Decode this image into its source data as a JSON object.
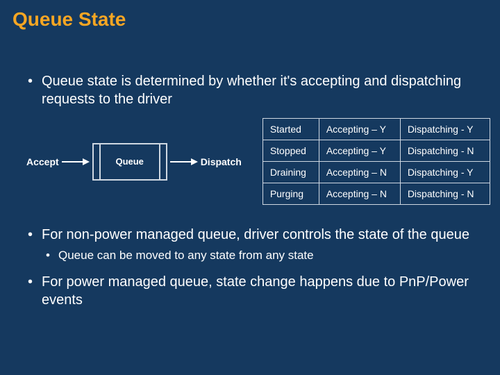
{
  "title": "Queue State",
  "bullets": {
    "b1": "Queue state is determined by whether it's accepting and dispatching requests to the driver",
    "b2": "For non-power managed queue, driver controls the state of the queue",
    "b2_sub": "Queue can be moved to any state from any state",
    "b3": "For power managed queue, state change happens due to PnP/Power events"
  },
  "diagram": {
    "accept_label": "Accept",
    "dispatch_label": "Dispatch",
    "queue_label": "Queue"
  },
  "table": {
    "rows": [
      {
        "state": "Started",
        "accept": "Accepting – Y",
        "dispatch": "Dispatching - Y"
      },
      {
        "state": "Stopped",
        "accept": "Accepting – Y",
        "dispatch": "Dispatching - N"
      },
      {
        "state": "Draining",
        "accept": "Accepting – N",
        "dispatch": "Dispatching - Y"
      },
      {
        "state": "Purging",
        "accept": "Accepting – N",
        "dispatch": "Dispatching - N"
      }
    ]
  }
}
